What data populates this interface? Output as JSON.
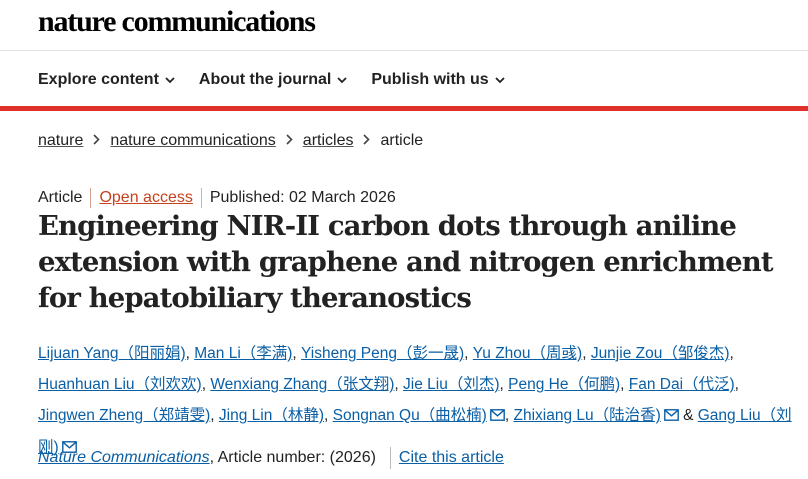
{
  "header": {
    "logo_text": "nature communications"
  },
  "nav": {
    "items": [
      {
        "label": "Explore content"
      },
      {
        "label": "About the journal"
      },
      {
        "label": "Publish with us"
      }
    ]
  },
  "breadcrumb": {
    "items": [
      "nature",
      "nature communications",
      "articles"
    ],
    "current": "article"
  },
  "article": {
    "type": "Article",
    "access": "Open access",
    "published": "Published: 02 March 2026",
    "title": "Engineering NIR-II carbon dots through aniline extension with graphene and nitrogen enrichment for hepatobiliary theranostics",
    "authors": [
      "Lijuan Yang（阳丽娟)",
      "Man Li（李满)",
      "Yisheng Peng（彭一晟)",
      "Yu Zhou（周彧)",
      "Junjie Zou（邹俊杰)",
      "Huanhuan Liu（刘欢欢)",
      "Wenxiang Zhang（张文翔)",
      "Jie Liu（刘杰)",
      "Peng He（何鹏)",
      "Fan Dai（代泛)",
      "Jingwen Zheng（郑靖雯)",
      "Jing Lin（林静)",
      "Songnan Qu（曲松楠)",
      "Zhixiang Lu（陆治香)",
      "Gang Liu（刘刚)"
    ],
    "sep_comma": ",",
    "sep_and": "&",
    "journal": "Nature Communications",
    "article_number": ", Article number:  (2026)",
    "cite": "Cite this article"
  },
  "colors": {
    "accent_red": "#e0302a",
    "link_blue": "#0b5fa5",
    "open_access": "#c6421d"
  },
  "icons": {
    "nav_dropdown": "chevron-down-icon",
    "breadcrumb_sep": "chevron-right-icon",
    "email": "mail-icon"
  }
}
